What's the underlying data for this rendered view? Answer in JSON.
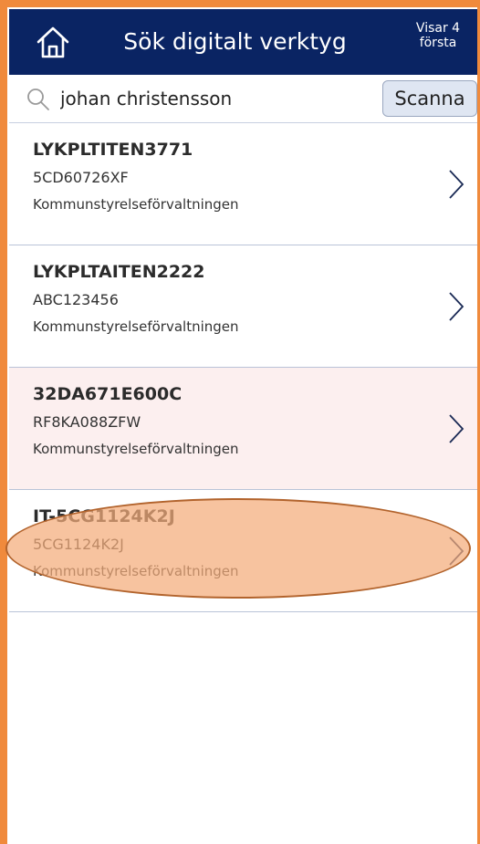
{
  "header": {
    "title": "Sök digitalt verktyg",
    "count_line1": "Visar 4",
    "count_line2": "första"
  },
  "search": {
    "value": "johan christensson",
    "scan_label": "Scanna"
  },
  "results": [
    {
      "name": "LYKPLTITEN3771",
      "serial": "5CD60726XF",
      "org": "Kommunstyrelseförvaltningen"
    },
    {
      "name": "LYKPLTAITEN2222",
      "serial": "ABC123456",
      "org": "Kommunstyrelseförvaltningen"
    },
    {
      "name": "32DA671E600C",
      "serial": "RF8KA088ZFW",
      "org": "Kommunstyrelseförvaltningen"
    },
    {
      "name": "IT-5CG1124K2J",
      "serial": "5CG1124K2J",
      "org": "Kommunstyrelseförvaltningen"
    }
  ],
  "colors": {
    "header_bg": "#0a2463",
    "frame_accent": "#f08a3c",
    "selected_row_bg": "#fcefef",
    "annotation_fill": "#f4ac7a"
  },
  "icons": {
    "home": "home-icon",
    "search": "search-icon",
    "chevron": "chevron-right-icon"
  }
}
